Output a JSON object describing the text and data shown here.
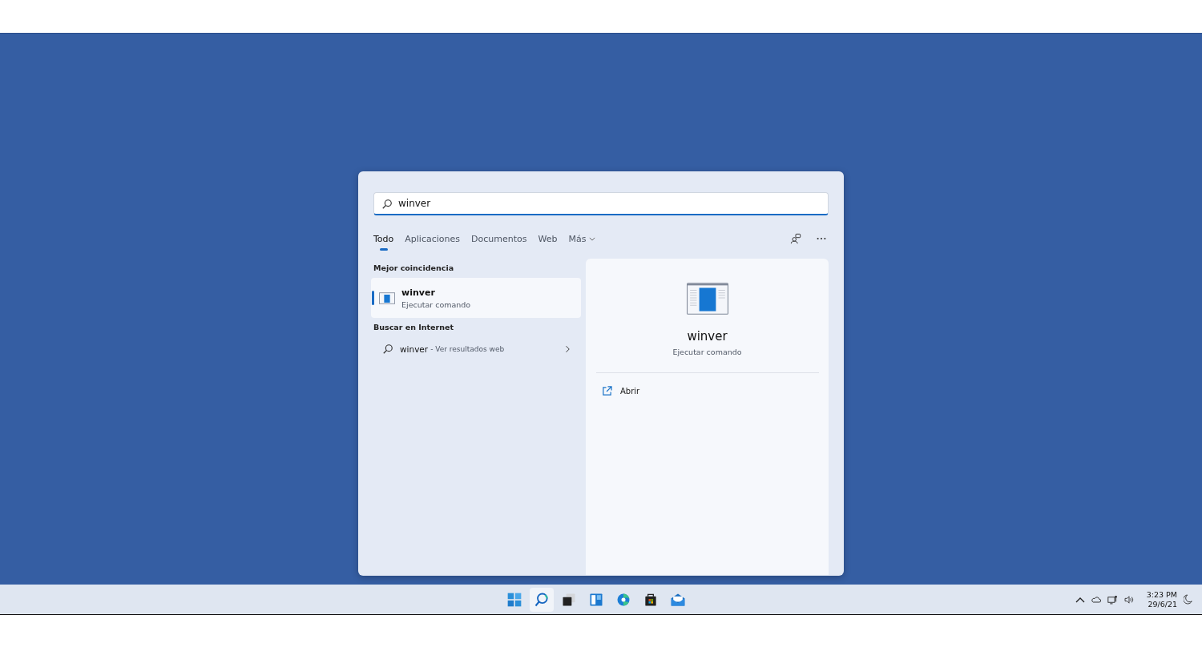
{
  "search": {
    "value": "winver"
  },
  "tabs": [
    {
      "label": "Todo",
      "selected": true
    },
    {
      "label": "Aplicaciones",
      "selected": false
    },
    {
      "label": "Documentos",
      "selected": false
    },
    {
      "label": "Web",
      "selected": false
    },
    {
      "label": "Más",
      "selected": false,
      "kind": "dropdown"
    }
  ],
  "best_match": {
    "heading": "Mejor coincidencia",
    "title": "winver",
    "subtitle": "Ejecutar comando",
    "selected": true
  },
  "web_search": {
    "heading": "Buscar en Internet",
    "query": "winver",
    "suffix": "- Ver resultados web"
  },
  "preview": {
    "title": "winver",
    "subtitle": "Ejecutar comando",
    "actions": [
      {
        "label": "Abrir"
      }
    ]
  },
  "taskbar": {
    "apps": [
      {
        "kind": "start",
        "selected": false
      },
      {
        "kind": "search",
        "selected": true
      },
      {
        "kind": "taskview",
        "selected": false
      },
      {
        "kind": "widgets",
        "selected": false
      },
      {
        "kind": "browser",
        "selected": false
      },
      {
        "kind": "store",
        "selected": false
      },
      {
        "kind": "mail",
        "selected": false
      }
    ]
  },
  "tray": {
    "time": "3:23 PM",
    "date": "29/6/21"
  }
}
